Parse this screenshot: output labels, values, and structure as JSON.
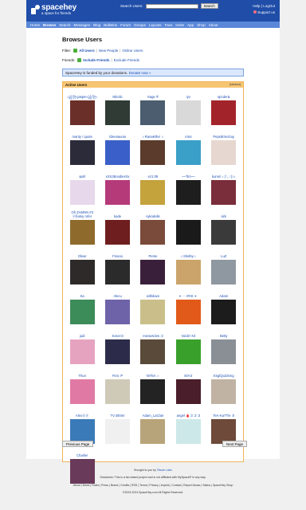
{
  "header": {
    "site_name": "spacehey",
    "tagline": "a space for friends",
    "search_label": "Search Users:",
    "search_value": "",
    "search_button": "Search",
    "help": "Help",
    "logout": "LogOut",
    "support": "Support us"
  },
  "nav": [
    "Home",
    "Browse",
    "Search",
    "Messages",
    "Blog",
    "Bulletins",
    "Forum",
    "Groups",
    "Layouts",
    "Favs",
    "Invite",
    "App",
    "Shop",
    "About"
  ],
  "page": {
    "title": "Browse Users",
    "filter_label": "Filter:",
    "filter_all": "All Users",
    "filter_new": "New People",
    "filter_online": "Online Users",
    "friends_label": "Friends:",
    "friends_include": "Include Friends",
    "friends_exclude": "Exclude Friends",
    "notice_text": "SpaceHey is funded by your donations.",
    "notice_link": "Donate now »",
    "box_title": "Active Users",
    "view_all": "[random]",
    "prev_button": "Previous Page",
    "next_button": "Next Page"
  },
  "users": [
    {
      "name": "꧁꧂jasper꧁꧂",
      "bg": "#6b2f2a"
    },
    {
      "name": "Nikolic",
      "bg": "#2f3b34"
    },
    {
      "name": "Sage ®",
      "bg": "#4b5d6e"
    },
    {
      "name": "iyx",
      "bg": "#d9d9d9"
    },
    {
      "name": "sp1der&",
      "bg": "#a3232a"
    },
    {
      "name": "manty / quote",
      "bg": "#2b2b3a"
    },
    {
      "name": "Gleesaurus",
      "bg": "#3a5fc8"
    },
    {
      "name": "☆RanaKiller ☆",
      "bg": "#5a3b2c"
    },
    {
      "name": "Aira!",
      "bg": "#3aa0c8"
    },
    {
      "name": "PepsiEmoGuy",
      "bg": "#e6d7d0"
    },
    {
      "name": "april",
      "bg": "#e8d8ec"
    },
    {
      "name": "xXSJBoodiesXx",
      "bg": "#b53a7a"
    },
    {
      "name": "ez1:09",
      "bg": "#c4a23c"
    },
    {
      "name": "~~Tim~~",
      "bg": "#1e1e1e"
    },
    {
      "name": "kunoi! ♪ (ᐢ◡ᐢ)ﾉ♪",
      "bg": "#7a2d3a"
    },
    {
      "name": "Oh ZAMNN #3 \u001ffunky nrfer",
      "bg": "#8e6a2c"
    },
    {
      "name": "kade",
      "bg": "#6e1e1e"
    },
    {
      "name": "sykodelik",
      "bg": "#7a4a3a"
    },
    {
      "name": "",
      "bg": "#1a1a1a"
    },
    {
      "name": "sirk",
      "bg": "#3a3a3a"
    },
    {
      "name": "Oliver",
      "bg": "#2e2a2a"
    },
    {
      "name": "Finooo",
      "bg": "#2b2b2b"
    },
    {
      "name": "Perse",
      "bg": "#3a1f3a"
    },
    {
      "name": "☆Shelby☆",
      "bg": "#caa46a"
    },
    {
      "name": "LuZ",
      "bg": "#8f97a0"
    },
    {
      "name": "Ka",
      "bg": "#3c8c5a"
    },
    {
      "name": "Alecu",
      "bg": "#6e63a8"
    },
    {
      "name": "wilt/dave",
      "bg": "#cabf8a"
    },
    {
      "name": "✦ ··· IRIS ✦·",
      "bg": "#e25a1a"
    },
    {
      "name": "Adam",
      "bg": "#1c1c1c"
    },
    {
      "name": "judi",
      "bg": "#e6a3c0"
    },
    {
      "name": "Soso<3",
      "bg": "#2c2c4a"
    },
    {
      "name": "meowscles :3",
      "bg": "#5a4a3a"
    },
    {
      "name": "Voidz! X3",
      "bg": "#3aa02c"
    },
    {
      "name": "Betty",
      "bg": "#8a8f96"
    },
    {
      "name": "Thun",
      "bg": "#e07aa4"
    },
    {
      "name": "Finn :P",
      "bg": "#cfcab8"
    },
    {
      "name": "NIT5A ☆",
      "bg": "#232323"
    },
    {
      "name": "E0<3",
      "bg": "#4a1e2a"
    },
    {
      "name": "EnglQu33nng",
      "bg": "#c0b3a4"
    },
    {
      "name": "AlexⓍⓍ",
      "bg": "#3a7ab8"
    },
    {
      "name": "TV.400mr",
      "bg": "#f0f0f0"
    },
    {
      "name": "Adam_LaClair",
      "bg": "#b8a47a"
    },
    {
      "name": "angel 🩸:3 :3 :3",
      "bg": "#cde8e8"
    },
    {
      "name": "TeA-KaTTle :0",
      "bg": "#6e4a3a"
    },
    {
      "name": "Charlie!",
      "bg": "#6a3a5a"
    }
  ],
  "footer": {
    "brought": "Brought to you by",
    "author": "Tibush Labs",
    "disclaimer": "Disclaimer: This is a fan-based project and is not affiliated with MySpace® in any way.",
    "links": "About | News | Rules | Press | Brand | Credits | RSS | Terms | Privacy | Imprint | Contact | Report Abuse | Status | SpaceHey Shop",
    "copyright": "©2023-2024 SpaceHey.com All Rights Reserved."
  }
}
